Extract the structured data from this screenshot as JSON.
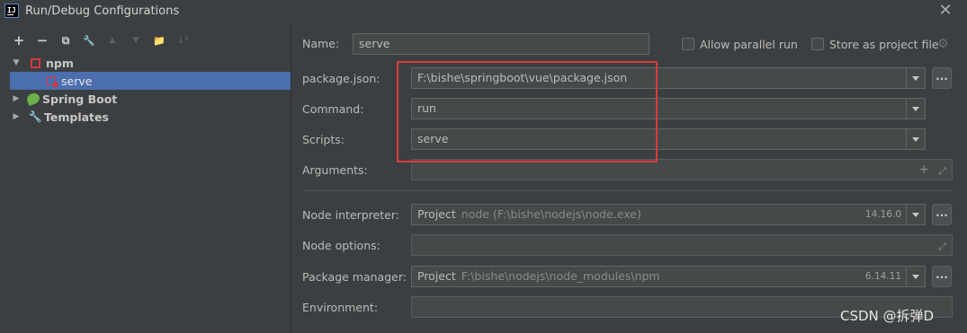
{
  "window": {
    "title": "Run/Debug Configurations",
    "app_icon_text": "IJ"
  },
  "toolbar": {
    "add": "+",
    "remove": "−",
    "copy": "⧉",
    "edit": "🔧",
    "up": "▲",
    "down": "▼",
    "folder": "📁",
    "sort": "↓²"
  },
  "tree": {
    "npm": "npm",
    "serve": "serve",
    "spring_boot": "Spring Boot",
    "templates": "Templates"
  },
  "form": {
    "name_label": "Name:",
    "name_value": "serve",
    "allow_parallel_label": "Allow parallel run",
    "store_as_project_label": "Store as project file",
    "package_json_label": "package.json:",
    "package_json_value": "F:\\bishe\\springboot\\vue\\package.json",
    "command_label": "Command:",
    "command_value": "run",
    "scripts_label": "Scripts:",
    "scripts_value": "serve",
    "arguments_label": "Arguments:",
    "node_interpreter_label": "Node interpreter:",
    "node_interpreter_project": "Project",
    "node_interpreter_path": "node (F:\\bishe\\nodejs\\node.exe)",
    "node_interpreter_version": "14.16.0",
    "node_options_label": "Node options:",
    "package_manager_label": "Package manager:",
    "package_manager_project": "Project",
    "package_manager_path": "F:\\bishe\\nodejs\\node_modules\\npm",
    "package_manager_version": "6.14.11",
    "environment_label": "Environment:",
    "dots": "..."
  },
  "watermark": "CSDN @拆弹D",
  "colors": {
    "highlight": "#e03a3a",
    "selection": "#4b6eaf",
    "background": "#3c3f41"
  }
}
